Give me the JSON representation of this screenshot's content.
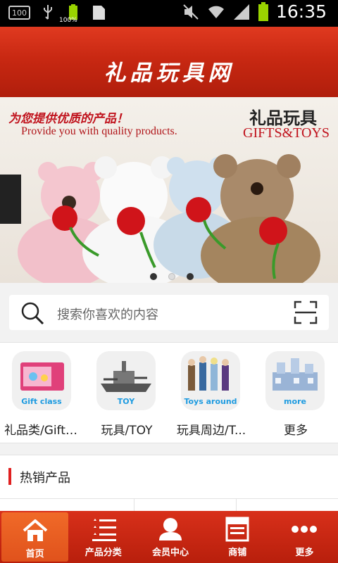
{
  "status_bar": {
    "left_badge": "100",
    "battery_text": "100%",
    "time": "16:35"
  },
  "header": {
    "title": "礼品玩具网"
  },
  "banner": {
    "tagline_cn": "为您提供优质的产品！",
    "tagline_en": "Provide you with quality products.",
    "brand_cn": "礼品玩具",
    "brand_en": "GIFTS&TOYS"
  },
  "search": {
    "placeholder": "搜索你喜欢的内容"
  },
  "categories": [
    {
      "label": "礼品类/Gift ...",
      "tag": "Gift class",
      "icon": "gift-box-toy-image"
    },
    {
      "label": "玩具/TOY",
      "tag": "TOY",
      "icon": "toy-ship-image"
    },
    {
      "label": "玩具周边/T...",
      "tag": "Toys around",
      "icon": "toy-figures-image"
    },
    {
      "label": "更多",
      "tag": "more",
      "icon": "toy-castle-image"
    }
  ],
  "section": {
    "title": "热销产品"
  },
  "bottom_nav": [
    {
      "label": "首页",
      "icon": "home-icon"
    },
    {
      "label": "产品分类",
      "icon": "category-list-icon"
    },
    {
      "label": "会员中心",
      "icon": "user-icon"
    },
    {
      "label": "商铺",
      "icon": "shop-icon"
    },
    {
      "label": "更多",
      "icon": "more-dots-icon"
    }
  ],
  "colors": {
    "brand_red": "#c82812",
    "accent_orange": "#e0521c",
    "link_blue": "#1e9be0"
  }
}
